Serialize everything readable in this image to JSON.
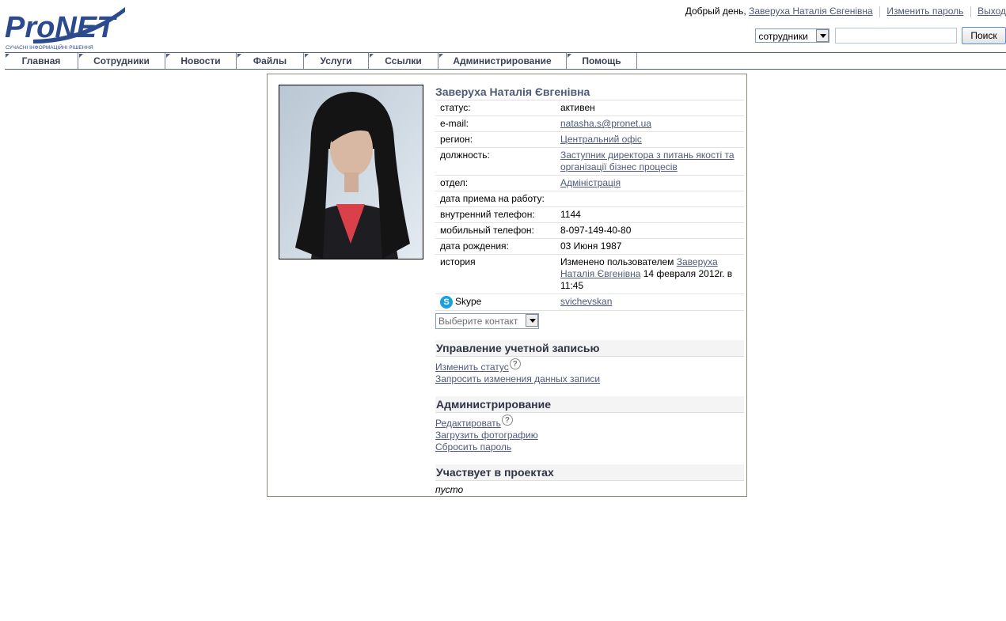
{
  "logo": {
    "text": "ProNET",
    "tagline": "СУЧАСНІ ІНФОРМАЦІЙНІ РІШЕННЯ"
  },
  "topbar": {
    "greeting": "Добрый день,",
    "user_name": "Заверуха Наталія Євгенівна",
    "change_password": "Изменить пароль",
    "logout": "Выход"
  },
  "search": {
    "category": "сотрудники",
    "value": "",
    "button": "Поиск"
  },
  "nav": [
    "Главная",
    "Сотрудники",
    "Новости",
    "Файлы",
    "Услуги",
    "Ссылки",
    "Администрирование",
    "Помощь"
  ],
  "profile": {
    "name": "Заверуха Наталія Євгенівна",
    "fields": {
      "status_label": "статус:",
      "status_value": "активен",
      "email_label": "e-mail:",
      "email_value": "natasha.s@pronet.ua",
      "region_label": "регион:",
      "region_value": "Центральний офіс",
      "position_label": "должность:",
      "position_value": "Заступник директора з питань якості та організації бізнес процесів",
      "department_label": "отдел:",
      "department_value": "Адміністрація",
      "hire_date_label": "дата приема на работу:",
      "hire_date_value": "",
      "internal_phone_label": "внутренний телефон:",
      "internal_phone_value": "1144",
      "mobile_label": "мобильный телефон:",
      "mobile_value": "8-097-149-40-80",
      "birth_label": "дата рождения:",
      "birth_value": "03 Июня 1987",
      "history_label": "история",
      "history_prefix": "Изменено пользователем",
      "history_user": "Заверуха Наталія Євгенівна",
      "history_suffix": "14 февраля 2012г. в 11:45",
      "skype_label": "Skype",
      "skype_value": "svichevskan"
    },
    "contact_select": "Выберите контакт"
  },
  "account": {
    "title": "Управление учетной записью",
    "change_status": "Изменить статус",
    "request_changes": "Запросить изменения данных записи"
  },
  "admin": {
    "title": "Администрирование",
    "edit": "Редактировать",
    "upload_photo": "Загрузить фотографию",
    "reset_password": "Сбросить пароль"
  },
  "projects": {
    "title": "Участвует в проектах",
    "empty": "пусто"
  },
  "colors": {
    "brand": "#2c4a8e",
    "link": "#4f5a78",
    "nav_border": "#52607c"
  }
}
